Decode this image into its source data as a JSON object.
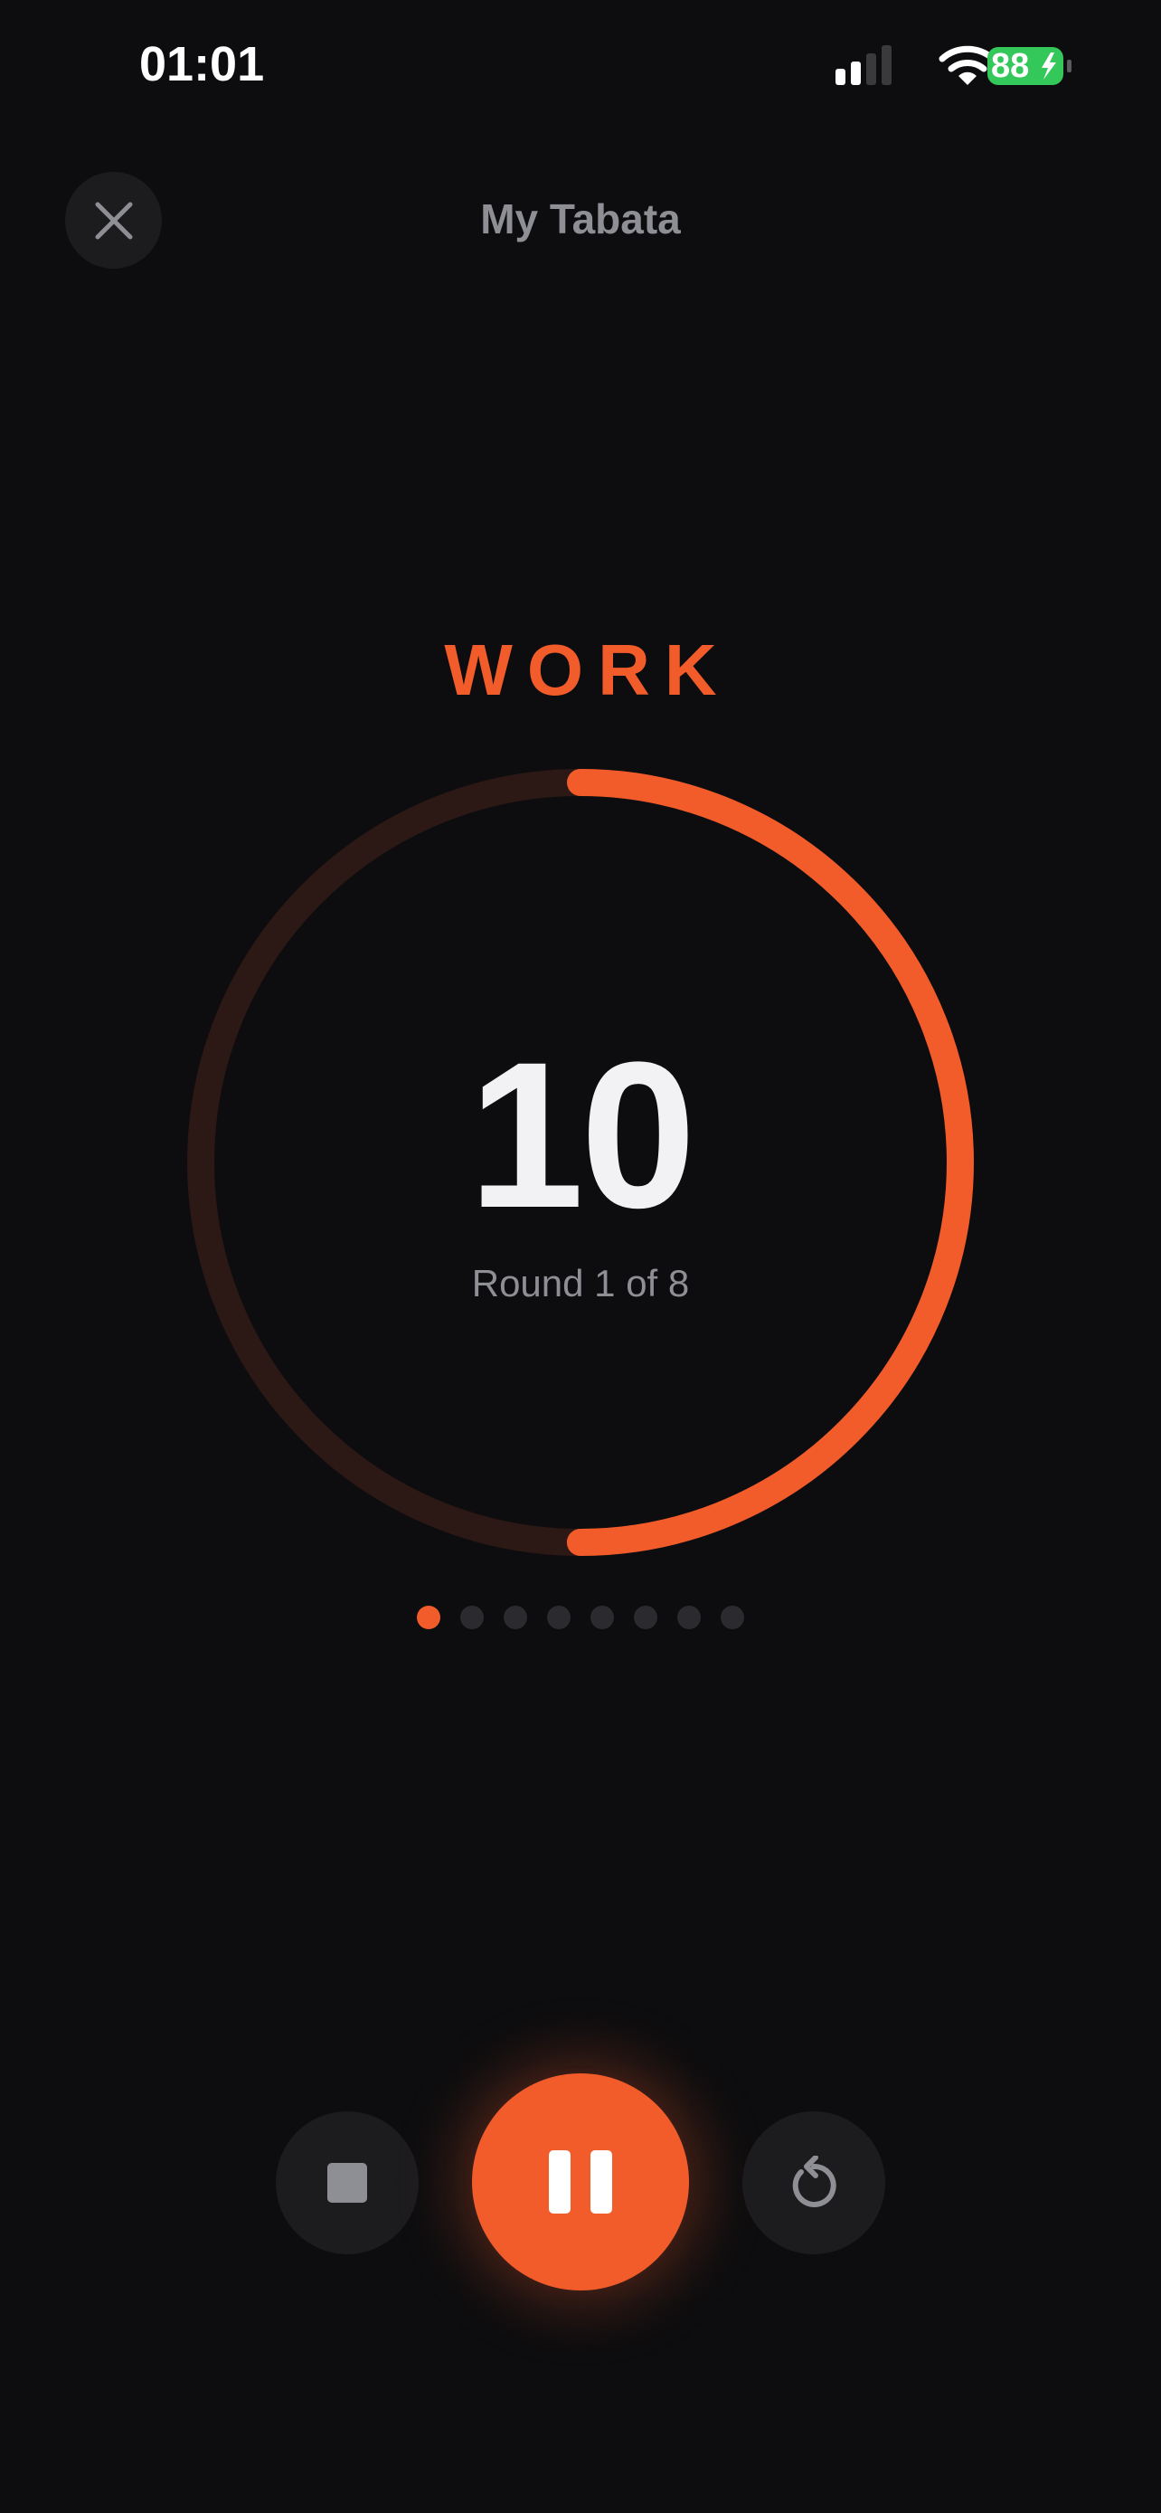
{
  "status_bar": {
    "time": "01:01",
    "battery_level": "88",
    "battery_color": "#34c759",
    "icons": [
      "signal-icon",
      "wifi-icon",
      "battery-charging-icon"
    ]
  },
  "header": {
    "title": "My Tabata",
    "close_icon": "close-icon"
  },
  "timer": {
    "phase": "WORK",
    "seconds": "10",
    "round_text": "Round 1 of 8",
    "phase_progress": 0.5,
    "accent_color": "#f25c2a",
    "track_color": "#2c1814"
  },
  "rounds": {
    "total": 8,
    "current": 1
  },
  "controls": {
    "stop_icon": "stop-icon",
    "pause_icon": "pause-icon",
    "reset_icon": "restart-icon"
  }
}
